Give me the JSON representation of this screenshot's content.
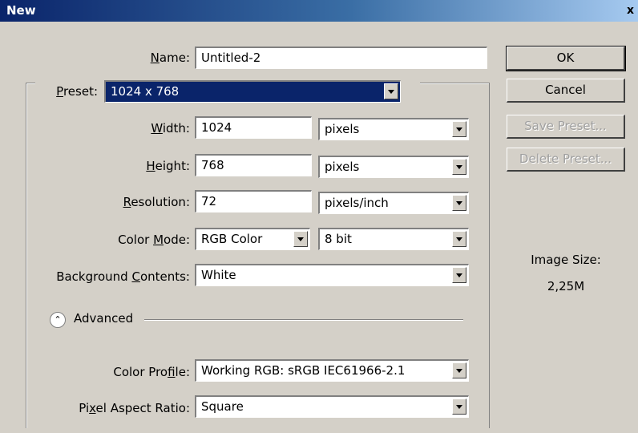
{
  "window": {
    "title": "New",
    "close_glyph": "x"
  },
  "name_row": {
    "label": "Name:",
    "label_underline": "N",
    "label_rest": "ame:",
    "value": "Untitled-2"
  },
  "preset": {
    "label_underline": "P",
    "label_rest": "reset:",
    "value": "1024 x 768"
  },
  "width": {
    "label_underline": "W",
    "label_rest": "idth:",
    "value": "1024",
    "unit": "pixels"
  },
  "height": {
    "label_underline": "H",
    "label_rest": "eight:",
    "value": "768",
    "unit": "pixels"
  },
  "resolution": {
    "label_underline": "R",
    "label_rest": "esolution:",
    "value": "72",
    "unit": "pixels/inch"
  },
  "color_mode": {
    "label_pre": "Color ",
    "label_underline": "M",
    "label_rest": "ode:",
    "mode": "RGB Color",
    "depth": "8 bit"
  },
  "background": {
    "label_pre": "Background ",
    "label_underline": "C",
    "label_rest": "ontents:",
    "value": "White"
  },
  "advanced": {
    "label": "Advanced",
    "toggle_icon": "chevron-up-icon",
    "toggle_glyph": "⌃"
  },
  "color_profile": {
    "label_pre": "Color Pro",
    "label_underline": "f",
    "label_rest": "ile:",
    "value": "Working RGB:  sRGB IEC61966-2.1"
  },
  "pixel_aspect": {
    "label_pre": "Pi",
    "label_underline": "x",
    "label_rest": "el Aspect Ratio:",
    "value": "Square"
  },
  "buttons": {
    "ok": "OK",
    "cancel": "Cancel",
    "save_preset": "Save Preset...",
    "delete_preset": "Delete Preset..."
  },
  "image_size": {
    "label": "Image Size:",
    "value": "2,25M"
  },
  "colors": {
    "title_start": "#0a246a",
    "title_end": "#a6caf0",
    "dialog_bg": "#d4d0c8",
    "selection": "#0a246a"
  }
}
